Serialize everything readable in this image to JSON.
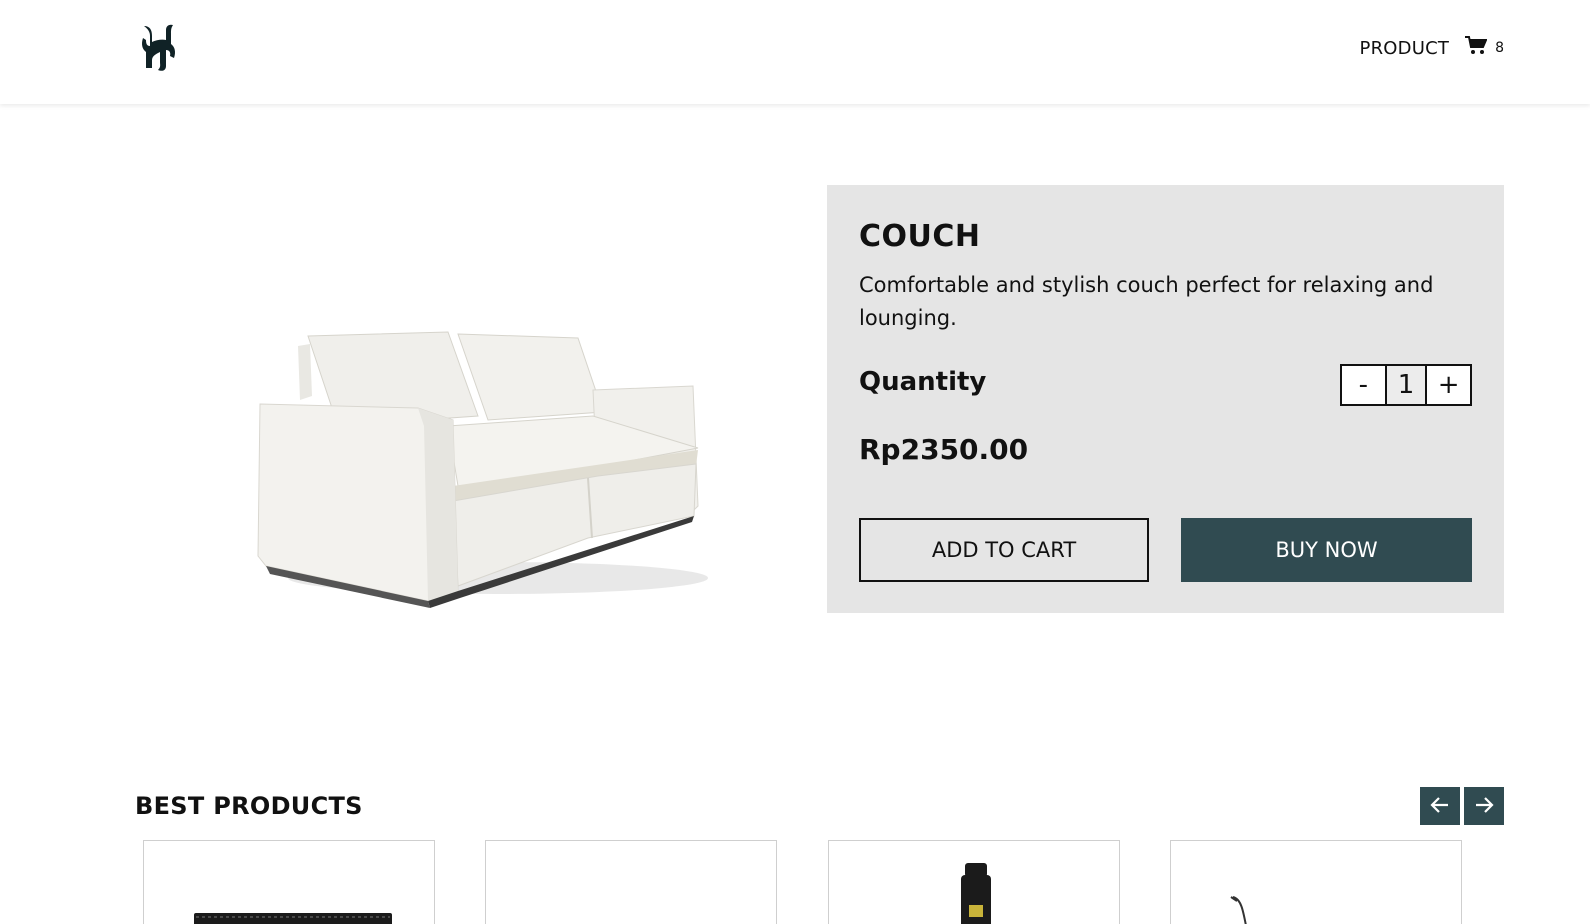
{
  "header": {
    "logo": "H",
    "nav": {
      "product_label": "PRODUCT"
    },
    "cart": {
      "count": "8",
      "icon": "cart-icon"
    }
  },
  "product": {
    "title": "COUCH",
    "description": "Comfortable and stylish couch perfect for relaxing and lounging.",
    "quantity_label": "Quantity",
    "quantity": {
      "decrement_label": "-",
      "value": "1",
      "increment_label": "+"
    },
    "price": "Rp2350.00",
    "add_to_cart_label": "ADD TO CART",
    "buy_now_label": "BUY NOW"
  },
  "best_products": {
    "title": "BEST PRODUCTS",
    "prev_icon": "arrow-left-icon",
    "next_icon": "arrow-right-icon"
  },
  "colors": {
    "accent": "#304b51",
    "panel": "#e5e5e5"
  }
}
